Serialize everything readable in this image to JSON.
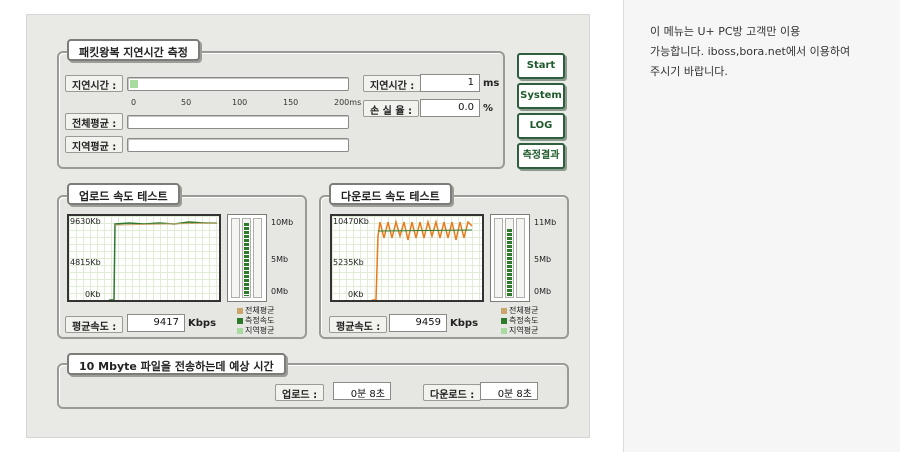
{
  "notice": {
    "line1": "이 메뉴는 U+ PC방 고객만 이용",
    "line2": "가능합니다. iboss,bora.net에서 이용하여",
    "line3": "주시기 바랍니다."
  },
  "latency": {
    "title": "패킷왕복 지연시간 측정",
    "delay_label": "지연시간 :",
    "total_avg_label": "전체평균 :",
    "region_avg_label": "지역평균 :",
    "scale": [
      "0",
      "50",
      "100",
      "150",
      "200ms"
    ],
    "delay_value_label": "지연시간 :",
    "delay_value": "1",
    "delay_unit": "ms",
    "loss_label": "손 실 율 :",
    "loss_value": "0.0",
    "loss_unit": "%",
    "delay_bar_fraction": 0.01
  },
  "buttons": {
    "start": "Start",
    "system": "System",
    "log": "LOG",
    "result": "측정결과"
  },
  "upload": {
    "title": "업로드 속도 테스트",
    "y_top": "9630Kb",
    "y_mid": "4815Kb",
    "y_bottom": "0Kb",
    "meter_top": "10Mb",
    "meter_mid": "5Mb",
    "meter_bottom": "0Mb",
    "legend": [
      "전체평균",
      "측정속도",
      "지역평균"
    ],
    "avg_label": "평균속도 :",
    "avg_value": "9417",
    "avg_unit": "Kbps",
    "meter_level": 0.94
  },
  "download": {
    "title": "다운로드 속도 테스트",
    "y_top": "10470Kb",
    "y_mid": "5235Kb",
    "y_bottom": "0Kb",
    "meter_top": "11Mb",
    "meter_mid": "5Mb",
    "meter_bottom": "0Mb",
    "legend": [
      "전체평균",
      "측정속도",
      "지역평균"
    ],
    "avg_label": "평균속도 :",
    "avg_value": "9459",
    "avg_unit": "Kbps",
    "meter_level": 0.86
  },
  "transfer": {
    "title": "10 Mbyte 파일을 전송하는데 예상 시간",
    "upload_label": "업로드 :",
    "upload_value": "0분 8초",
    "download_label": "다운로드 :",
    "download_value": "0분 8초"
  },
  "colors": {
    "measured": "#2d7a2d",
    "total_avg": "#c9a56a",
    "region_avg": "#a8dba0",
    "download_line": "#e87a1a"
  }
}
